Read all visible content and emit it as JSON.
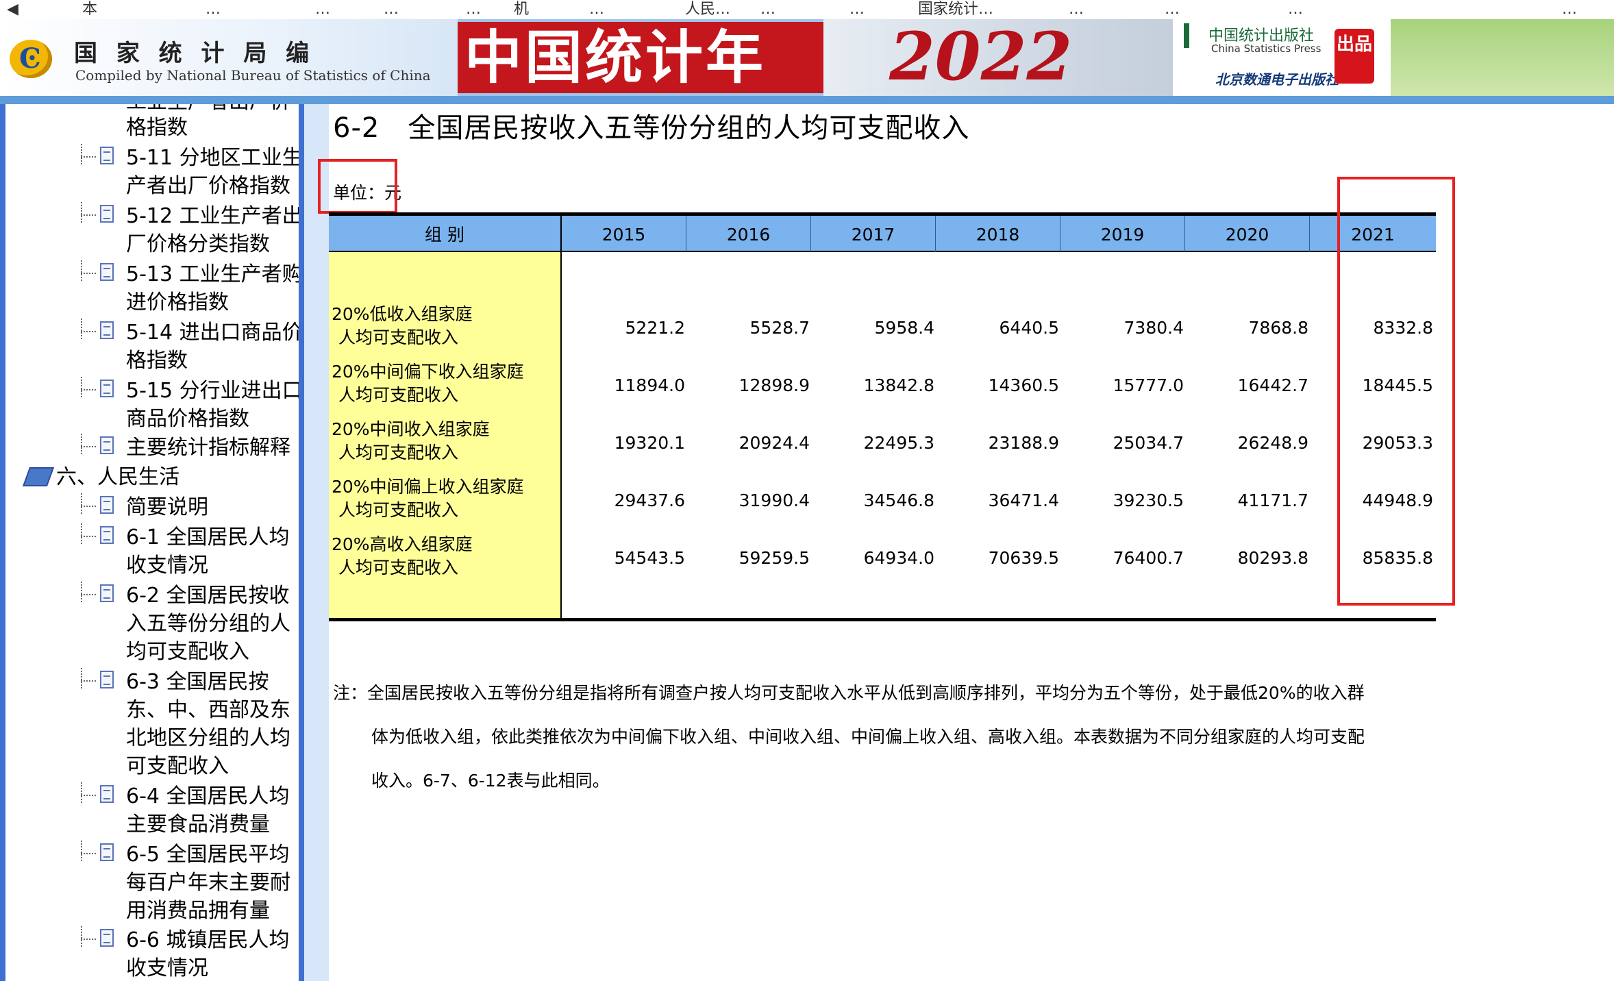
{
  "bookmarks": [
    "◀",
    "本",
    "…",
    "…",
    "…",
    "…",
    "机",
    "…",
    "人民…",
    "…",
    "…",
    "国家统计…",
    "…",
    "…",
    "…",
    "…"
  ],
  "header": {
    "logo_glyph": "Ͼ",
    "org_name": "国 家 统 计 局   编",
    "org_name_en": "Compiled by National Bureau of Statistics of China",
    "book_title": "中国统计年鉴",
    "year": "2022",
    "publisher_cn": "中国统计出版社",
    "publisher_en": "China Statistics Press",
    "publisher_bj": "北京数通电子出版社",
    "stamp": "出品"
  },
  "sidebar": {
    "items": [
      {
        "label": "工业生产者出厂价",
        "partial": true
      },
      {
        "label": "格指数"
      },
      {
        "label": "5-11 分地区工业生产者出厂价格指数"
      },
      {
        "label": "5-12 工业生产者出厂价格分类指数"
      },
      {
        "label": "5-13 工业生产者购进价格指数"
      },
      {
        "label": "5-14 进出口商品价格指数"
      },
      {
        "label": "5-15 分行业进出口商品价格指数"
      },
      {
        "label": "主要统计指标解释"
      }
    ],
    "section": "六、人民生活",
    "section_items": [
      {
        "label": "简要说明"
      },
      {
        "label": "6-1 全国居民人均收支情况"
      },
      {
        "label": "6-2 全国居民按收入五等份分组的人均可支配收入"
      },
      {
        "label": "6-3 全国居民按东、中、西部及东北地区分组的人均可支配收入"
      },
      {
        "label": "6-4 全国居民人均主要食品消费量"
      },
      {
        "label": "6-5 全国居民平均每百户年末主要耐用消费品拥有量"
      },
      {
        "label": "6-6 城镇居民人均收支情况"
      }
    ]
  },
  "content": {
    "title": "6-2　全国居民按收入五等份分组的人均可支配收入",
    "unit": "单位：元",
    "table": {
      "group_header": "组 别",
      "years": [
        "2015",
        "2016",
        "2017",
        "2018",
        "2019",
        "2020",
        "2021"
      ],
      "rows": [
        {
          "label_line1": "20%低收入组家庭",
          "label_line2": "人均可支配收入",
          "values": [
            "5221.2",
            "5528.7",
            "5958.4",
            "6440.5",
            "7380.4",
            "7868.8",
            "8332.8"
          ]
        },
        {
          "label_line1": "20%中间偏下收入组家庭",
          "label_line2": "人均可支配收入",
          "values": [
            "11894.0",
            "12898.9",
            "13842.8",
            "14360.5",
            "15777.0",
            "16442.7",
            "18445.5"
          ]
        },
        {
          "label_line1": "20%中间收入组家庭",
          "label_line2": "人均可支配收入",
          "values": [
            "19320.1",
            "20924.4",
            "22495.3",
            "23188.9",
            "25034.7",
            "26248.9",
            "29053.3"
          ]
        },
        {
          "label_line1": "20%中间偏上收入组家庭",
          "label_line2": "人均可支配收入",
          "values": [
            "29437.6",
            "31990.4",
            "34546.8",
            "36471.4",
            "39230.5",
            "41171.7",
            "44948.9"
          ]
        },
        {
          "label_line1": "20%高收入组家庭",
          "label_line2": "人均可支配收入",
          "values": [
            "54543.5",
            "59259.5",
            "64934.0",
            "70639.5",
            "76400.7",
            "80293.8",
            "85835.8"
          ]
        }
      ]
    },
    "notes": [
      "注：全国居民按收入五等份分组是指将所有调查户按人均可支配收入水平从低到高顺序排列，平均分为五个等份，处于最低20%的收入群",
      "体为低收入组，依此类推依次为中间偏下收入组、中间收入组、中间偏上收入组、高收入组。本表数据为不同分组家庭的人均可支配",
      "收入。6-7、6-12表与此相同。"
    ]
  },
  "colors": {
    "table_header": "#7ab3ee",
    "label_column": "#ffff99",
    "highlight_box": "#e52222",
    "sidebar_border": "#3f6fd0"
  }
}
